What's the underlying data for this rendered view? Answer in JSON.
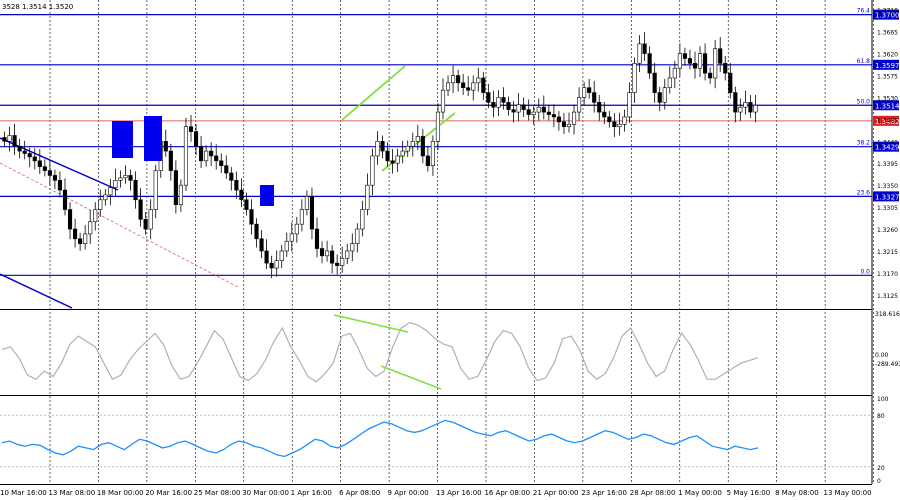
{
  "header": {
    "ohlc_text": "3528 1.3514 1.3520"
  },
  "colors": {
    "candle": "#000000",
    "fib_line": "#0000cc",
    "price_line": "#e06060",
    "trend_line": "#0000cc",
    "channel": "#7fe03a",
    "box": "#0000ee",
    "cci": "#b0b0b0",
    "rsi": "#1e90ff",
    "grid": "#000000"
  },
  "chart_data": [
    {
      "type": "candlestick",
      "title": "",
      "ylim": [
        1.31,
        1.373
      ],
      "y_ticks": [
        1.3125,
        1.317,
        1.3215,
        1.326,
        1.3305,
        1.335,
        1.3395,
        1.344,
        1.3485,
        1.353,
        1.3575,
        1.362,
        1.3665,
        1.371
      ],
      "y_tick_labels": [
        "1.3125",
        "1.3170",
        "1.3215",
        "1.3260",
        "1.3305",
        "1.3350",
        "1.3395",
        "1.3440",
        "1.3485",
        "1.3530",
        "1.3575",
        "1.3620",
        "1.3665",
        "1.3710"
      ],
      "x_labels": [
        "10 Mar 16:00",
        "13 Mar 08:00",
        "18 Mar 00:00",
        "20 Mar 16:00",
        "25 Mar 08:00",
        "30 Mar 00:00",
        "1 Apr 16:00",
        "6 Apr 08:00",
        "9 Apr 00:00",
        "13 Apr 16:00",
        "16 Apr 08:00",
        "21 Apr 00:00",
        "23 Apr 16:00",
        "28 Apr 08:00",
        "1 May 00:00",
        "5 May 16:00",
        "8 May 08:00",
        "13 May 00:00"
      ],
      "candles": 150,
      "series": [
        {
          "close_path": [
            1.344,
            1.3452,
            1.343,
            1.342,
            1.3415,
            1.3408,
            1.34,
            1.3388,
            1.338,
            1.337,
            1.336,
            1.334,
            1.33,
            1.326,
            1.324,
            1.323,
            1.325,
            1.3275,
            1.33,
            1.332,
            1.333,
            1.3345,
            1.336,
            1.3365,
            1.337,
            1.336,
            1.332,
            1.328,
            1.326,
            1.33,
            1.338,
            1.344,
            1.342,
            1.338,
            1.331,
            1.335,
            1.347,
            1.346,
            1.343,
            1.34,
            1.342,
            1.341,
            1.34,
            1.339,
            1.3375,
            1.336,
            1.334,
            1.332,
            1.33,
            1.327,
            1.324,
            1.3215,
            1.319,
            1.318,
            1.3195,
            1.3215,
            1.3235,
            1.325,
            1.327,
            1.33,
            1.3327,
            1.326,
            1.322,
            1.3205,
            1.3215,
            1.319,
            1.3185,
            1.32,
            1.3215,
            1.323,
            1.326,
            1.33,
            1.335,
            1.341,
            1.344,
            1.342,
            1.34,
            1.3395,
            1.341,
            1.342,
            1.343,
            1.344,
            1.345,
            1.341,
            1.339,
            1.344,
            1.35,
            1.3545,
            1.356,
            1.3575,
            1.356,
            1.355,
            1.3545,
            1.356,
            1.357,
            1.354,
            1.352,
            1.351,
            1.353,
            1.352,
            1.3505,
            1.35,
            1.3515,
            1.3505,
            1.3495,
            1.35,
            1.351,
            1.35,
            1.3495,
            1.349,
            1.348,
            1.347,
            1.3475,
            1.35,
            1.353,
            1.355,
            1.354,
            1.352,
            1.35,
            1.349,
            1.348,
            1.347,
            1.3475,
            1.349,
            1.354,
            1.36,
            1.364,
            1.362,
            1.358,
            1.354,
            1.352,
            1.355,
            1.357,
            1.359,
            1.362,
            1.361,
            1.36,
            1.359,
            1.362,
            1.358,
            1.357,
            1.363,
            1.36,
            1.358,
            1.354,
            1.35,
            1.351,
            1.352,
            1.35,
            1.3514
          ]
        }
      ],
      "fib_levels": [
        {
          "label": "76.4",
          "value": 1.37,
          "price_label": "1.3700"
        },
        {
          "label": "61.8",
          "value": 1.3597,
          "price_label": "1.3597"
        },
        {
          "label": "50.0",
          "value": 1.3514,
          "price_label": "1.3514"
        },
        {
          "label": "38.2",
          "value": 1.3429,
          "price_label": "1.3429"
        },
        {
          "label": "23.6",
          "value": 1.3327,
          "price_label": "1.3327"
        },
        {
          "label": "0.0",
          "value": 1.3165,
          "price_label": ""
        }
      ],
      "price_line": {
        "value": 1.3482,
        "label": "1.3482"
      }
    },
    {
      "type": "line",
      "title": "",
      "y_tick_labels": [
        "318.6161",
        "0.00",
        "-289.493"
      ],
      "ylim": [
        -289.493,
        318.6161
      ],
      "series": [
        {
          "values": [
            40,
            60,
            -20,
            -150,
            -180,
            -120,
            -160,
            -60,
            80,
            140,
            100,
            60,
            -60,
            -180,
            -150,
            -40,
            40,
            100,
            160,
            80,
            -80,
            -180,
            -160,
            -60,
            60,
            180,
            120,
            -20,
            -160,
            -190,
            -140,
            -40,
            100,
            200,
            60,
            -40,
            -160,
            -200,
            -140,
            -60,
            140,
            160,
            40,
            -100,
            -160,
            -120,
            60,
            200,
            240,
            220,
            180,
            120,
            80,
            60,
            -100,
            -180,
            -160,
            -40,
            100,
            180,
            160,
            60,
            -100,
            -190,
            -170,
            -60,
            120,
            140,
            40,
            -120,
            -180,
            -140,
            -20,
            140,
            200,
            80,
            -60,
            -160,
            -120,
            40,
            160,
            80,
            -40,
            -180,
            -180,
            -140,
            -100,
            -60,
            -40,
            -20
          ]
        }
      ]
    },
    {
      "type": "line",
      "title": "",
      "y_tick_labels": [
        "100",
        "80",
        "20",
        "0"
      ],
      "ylim": [
        0,
        100
      ],
      "series": [
        {
          "values": [
            48,
            50,
            46,
            44,
            46,
            45,
            40,
            36,
            34,
            38,
            44,
            42,
            40,
            46,
            48,
            44,
            40,
            46,
            52,
            50,
            46,
            42,
            44,
            48,
            50,
            46,
            42,
            38,
            36,
            40,
            46,
            50,
            48,
            44,
            42,
            38,
            34,
            32,
            36,
            40,
            46,
            52,
            50,
            44,
            42,
            46,
            52,
            58,
            64,
            68,
            72,
            70,
            66,
            62,
            60,
            62,
            66,
            70,
            74,
            72,
            68,
            64,
            60,
            58,
            56,
            60,
            62,
            58,
            54,
            50,
            52,
            56,
            58,
            54,
            50,
            48,
            50,
            54,
            58,
            62,
            60,
            56,
            52,
            54,
            58,
            56,
            52,
            48,
            46,
            50,
            54,
            56,
            50,
            44,
            42,
            40,
            44,
            42,
            40,
            42
          ]
        }
      ]
    }
  ]
}
